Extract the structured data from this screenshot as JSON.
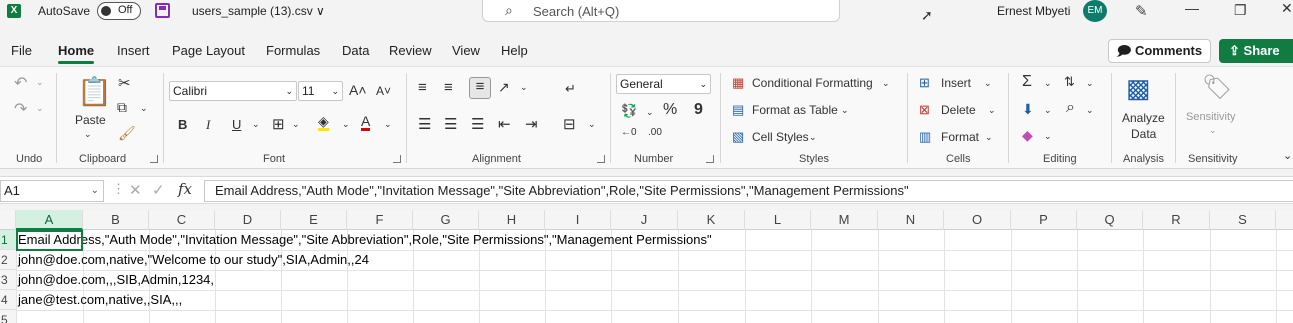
{
  "titlebar": {
    "app_logo": "X",
    "autosave_label": "AutoSave",
    "autosave_state": "Off",
    "filename": "users_sample (13).csv ∨",
    "search_placeholder": "Search (Alt+Q)",
    "user_name": "Ernest Mbyeti",
    "user_initials": "EM"
  },
  "tabs": [
    "File",
    "Home",
    "Insert",
    "Page Layout",
    "Formulas",
    "Data",
    "Review",
    "View",
    "Help"
  ],
  "active_tab": "Home",
  "actions": {
    "comments": "Comments",
    "share": "Share"
  },
  "ribbon": {
    "undo_group": "Undo",
    "clipboard": {
      "paste": "Paste",
      "label": "Clipboard"
    },
    "font": {
      "name": "Calibri",
      "size": "11",
      "bold": "B",
      "italic": "I",
      "underline": "U",
      "label": "Font"
    },
    "alignment": {
      "label": "Alignment"
    },
    "number": {
      "format": "General",
      "percent": "%",
      "comma": "9",
      "label": "Number"
    },
    "styles": {
      "conditional": "Conditional Formatting",
      "table": "Format as Table",
      "cell_styles": "Cell Styles",
      "label": "Styles"
    },
    "cells": {
      "insert": "Insert",
      "delete": "Delete",
      "format": "Format",
      "label": "Cells"
    },
    "editing": {
      "label": "Editing"
    },
    "analysis": {
      "analyze_line1": "Analyze",
      "analyze_line2": "Data",
      "label": "Analysis"
    },
    "sensitivity": {
      "button": "Sensitivity",
      "label": "Sensitivity"
    }
  },
  "formula_bar": {
    "name_box": "A1",
    "fx": "fx",
    "content": "Email Address,\"Auth Mode\",\"Invitation Message\",\"Site Abbreviation\",Role,\"Site Permissions\",\"Management Permissions\""
  },
  "grid": {
    "columns": [
      "A",
      "B",
      "C",
      "D",
      "E",
      "F",
      "G",
      "H",
      "I",
      "J",
      "K",
      "L",
      "M",
      "N",
      "O",
      "P",
      "Q",
      "R",
      "S"
    ],
    "rows": [
      "1",
      "2",
      "3",
      "4",
      "5"
    ],
    "cells": [
      "Email Address,\"Auth Mode\",\"Invitation Message\",\"Site Abbreviation\",Role,\"Site Permissions\",\"Management Permissions\"",
      "john@doe.com,native,\"Welcome to our study\",SIA,Admin,,24",
      "john@doe.com,,,SIB,Admin,1234,",
      "jane@test.com,native,,SIA,,,",
      ""
    ]
  }
}
